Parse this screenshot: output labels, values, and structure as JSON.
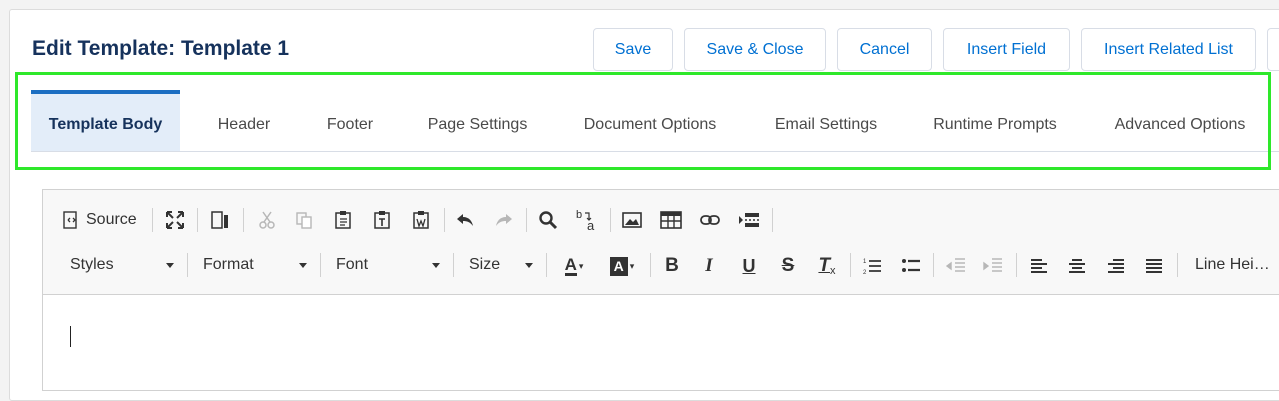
{
  "header": {
    "title": "Edit Template: Template 1",
    "buttons": [
      "Save",
      "Save & Close",
      "Cancel",
      "Insert Field",
      "Insert Related List"
    ]
  },
  "tabs": [
    {
      "label": "Template Body",
      "active": true
    },
    {
      "label": "Header"
    },
    {
      "label": "Footer"
    },
    {
      "label": "Page Settings"
    },
    {
      "label": "Document Options"
    },
    {
      "label": "Email Settings"
    },
    {
      "label": "Runtime Prompts"
    },
    {
      "label": "Advanced Options"
    }
  ],
  "editor": {
    "source_label": "Source",
    "styles_label": "Styles",
    "format_label": "Format",
    "font_label": "Font",
    "size_label": "Size",
    "line_height_label": "Line Hei…",
    "text_color_label": "A",
    "bg_color_label": "A",
    "bold_label": "B",
    "italic_label": "I",
    "underline_label": "U",
    "strike_label": "S",
    "remove_format_label": "T",
    "remove_format_sub": "x"
  },
  "colors": {
    "highlight": "#2ee82a",
    "title": "#16325c",
    "button_text": "#0070d2",
    "active_tab_bg": "#e3edf9",
    "active_tab_border": "#1b6ec2"
  }
}
